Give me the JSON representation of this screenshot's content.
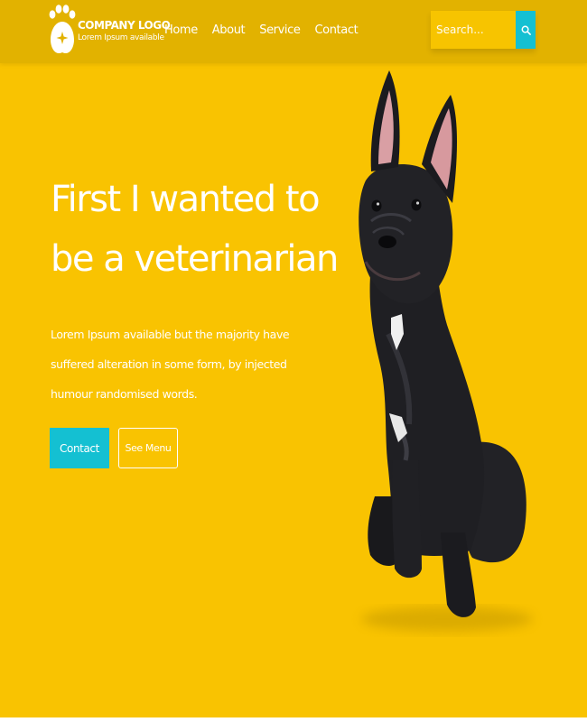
{
  "header": {
    "brand_name": "COMPANY LOGO",
    "brand_tagline": "Lorem Ipsum available",
    "nav": [
      {
        "label": "Home"
      },
      {
        "label": "About"
      },
      {
        "label": "Service"
      },
      {
        "label": "Contact"
      }
    ],
    "search": {
      "placeholder": "Search..."
    }
  },
  "hero": {
    "title": "First I wanted to be a veterinarian",
    "description": "Lorem Ipsum available but the majority have suffered alteration in some form, by injected humour randomised words.",
    "buttons": {
      "contact": "Contact",
      "see_menu": "See Menu"
    }
  },
  "icons": {
    "logo": "paw-print-icon",
    "search": "search-icon"
  },
  "colors": {
    "background": "#f9c301",
    "header": "#e2b200",
    "accent": "#14c0d2",
    "text": "#ffffff",
    "dog": "#1e1e22"
  }
}
